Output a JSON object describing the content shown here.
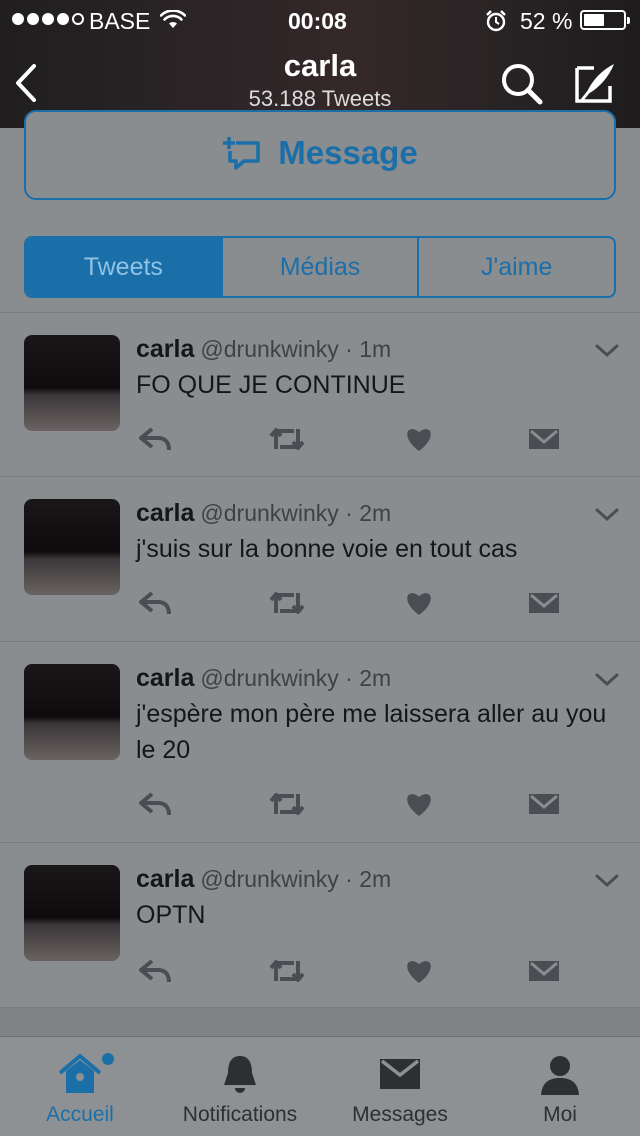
{
  "status_bar": {
    "carrier": "BASE",
    "time": "00:08",
    "battery_percent": "52 %",
    "battery_level": 0.52,
    "signal_bars_filled": 4,
    "signal_bars_total": 5
  },
  "header": {
    "title": "carla",
    "subtitle": "53.188 Tweets"
  },
  "message_button": {
    "label": "Message"
  },
  "tabs": [
    {
      "label": "Tweets",
      "active": true
    },
    {
      "label": "Médias",
      "active": false
    },
    {
      "label": "J'aime",
      "active": false
    }
  ],
  "tweets": [
    {
      "name": "carla",
      "handle": "@drunkwinky · 1m",
      "text": "FO QUE JE CONTINUE"
    },
    {
      "name": "carla",
      "handle": "@drunkwinky · 2m",
      "text": "j'suis sur la bonne voie en tout cas"
    },
    {
      "name": "carla",
      "handle": "@drunkwinky · 2m",
      "text": "j'espère mon père me laissera aller au you le 20"
    },
    {
      "name": "carla",
      "handle": "@drunkwinky · 2m",
      "text": "OPTN"
    }
  ],
  "tabbar": {
    "items": [
      {
        "label": "Accueil",
        "icon": "home-icon",
        "active": true
      },
      {
        "label": "Notifications",
        "icon": "bell-icon",
        "active": false
      },
      {
        "label": "Messages",
        "icon": "envelope-icon",
        "active": false
      },
      {
        "label": "Moi",
        "icon": "person-icon",
        "active": false
      }
    ]
  },
  "colors": {
    "accent": "#1b6fa8",
    "overlay_background": "#8a8d90"
  }
}
